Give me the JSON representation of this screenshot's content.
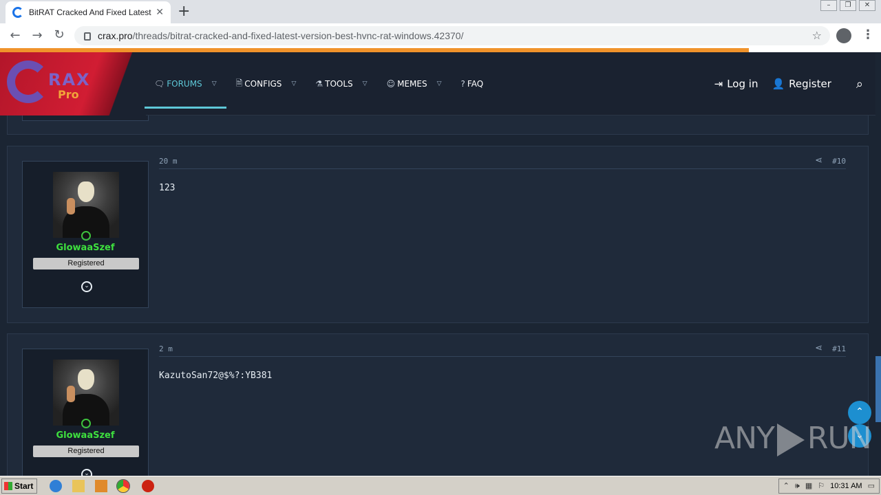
{
  "browser": {
    "tab_title": "BitRAT Cracked And Fixed Latest Ve",
    "tab_close": "✕",
    "new_tab": "+",
    "url_host": "crax.pro",
    "url_path": "/threads/bitrat-cracked-and-fixed-latest-version-best-hvnc-rat-windows.42370/",
    "page_load_progress": 0.85
  },
  "site": {
    "logo_c": "",
    "logo_rax": "RAX",
    "logo_pro": "Pro",
    "nav": [
      {
        "label": "FORUMS",
        "icon": "chat-icon",
        "active": true
      },
      {
        "label": "CONFIGS",
        "icon": "file-icon"
      },
      {
        "label": "TOOLS",
        "icon": "flask-icon"
      },
      {
        "label": "MEMES",
        "icon": "masks-icon"
      },
      {
        "label": "FAQ",
        "icon": "question-icon"
      }
    ],
    "login_label": "Log in",
    "register_label": "Register"
  },
  "posts": [
    {
      "time": "20 m",
      "number": "#10",
      "user": "GlowaaSzef",
      "role": "Registered",
      "message": "123"
    },
    {
      "time": "2 m",
      "number": "#11",
      "user": "GlowaaSzef",
      "role": "Registered",
      "message": "KazutoSan72@$%?:YB381"
    }
  ],
  "watermark": {
    "left": "ANY",
    "right": "RUN"
  },
  "taskbar": {
    "start_label": "Start",
    "clock": "10:31 AM"
  }
}
